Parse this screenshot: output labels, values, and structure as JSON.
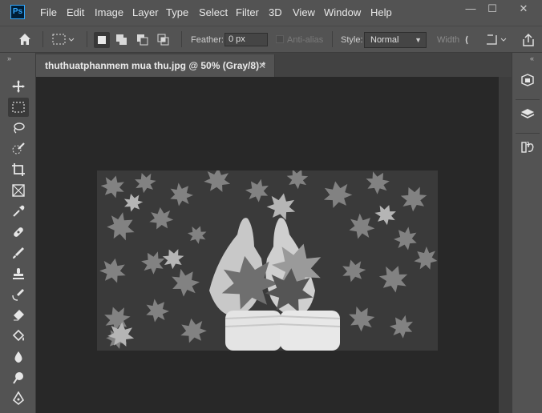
{
  "app": {
    "logo_text": "Ps"
  },
  "menu": [
    "File",
    "Edit",
    "Image",
    "Layer",
    "Type",
    "Select",
    "Filter",
    "3D",
    "View",
    "Window",
    "Help"
  ],
  "window_controls": {
    "minimize": "—",
    "maximize": "☐",
    "close": "✕"
  },
  "options": {
    "feather_label": "Feather:",
    "feather_value": "0 px",
    "antialias_label": "Anti-alias",
    "style_label": "Style:",
    "style_value": "Normal",
    "width_label": "Width"
  },
  "document": {
    "tab_title": "thuthuatphanmem mua thu.jpg @ 50% (Gray/8) *",
    "tab_close": "✕"
  },
  "colors": {
    "chrome": "#535353",
    "canvas_bg": "#282828",
    "tab_bar": "#424242",
    "accent": "#31a8ff"
  }
}
